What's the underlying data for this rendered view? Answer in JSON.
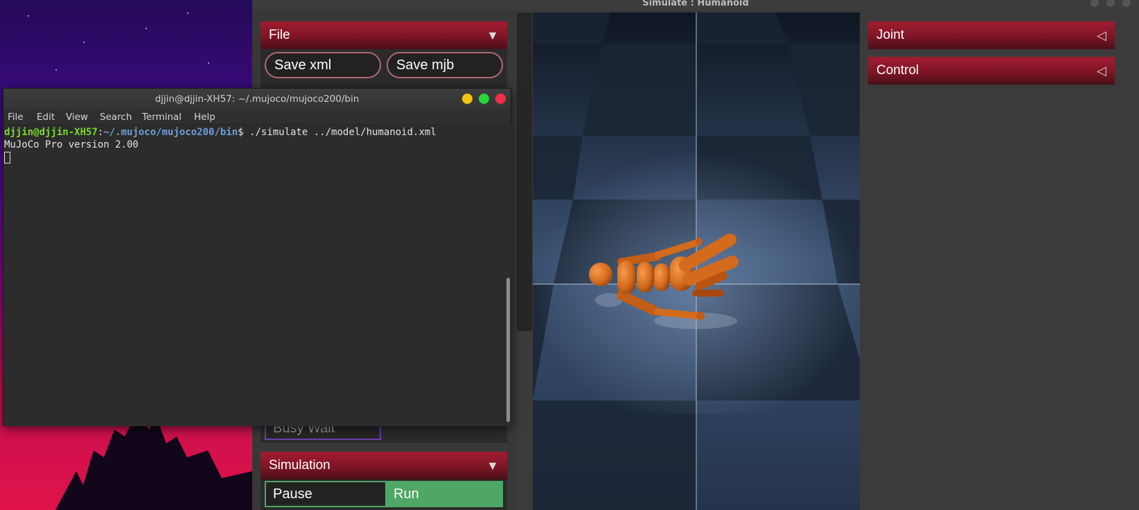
{
  "simulate_window": {
    "title": "Simulate : Humanoid",
    "file_section": {
      "title": "File",
      "arrow": "▼",
      "buttons": [
        "Save xml",
        "Save mjb"
      ],
      "busy_wait_label": "Busy Wait"
    },
    "simulation_section": {
      "title": "Simulation",
      "arrow": "▼",
      "options": [
        "Pause",
        "Run"
      ],
      "selected": "Run",
      "selected_color": "#4fa766"
    },
    "right_panel": [
      {
        "title": "Joint",
        "arrow": "◁"
      },
      {
        "title": "Control",
        "arrow": "◁"
      }
    ],
    "viewport": {
      "content": "humanoid-model",
      "model_color": "#d46a1c",
      "floor_color": "#3b5173"
    }
  },
  "terminal": {
    "title": "djjin@djjin-XH57: ~/.mujoco/mujoco200/bin",
    "menu": [
      "File",
      "Edit",
      "View",
      "Search",
      "Terminal",
      "Help"
    ],
    "prompt_user": "djjin@djjin-XH57",
    "prompt_sep": ":",
    "prompt_path": "~/.mujoco/mujoco200/bin",
    "prompt_symbol": "$",
    "command": " ./simulate ../model/humanoid.xml",
    "output": [
      "MuJoCo Pro version 2.00"
    ],
    "buttons": {
      "minimize_color": "#f5c211",
      "maximize_color": "#2bd43a",
      "close_color": "#f0304a"
    }
  }
}
